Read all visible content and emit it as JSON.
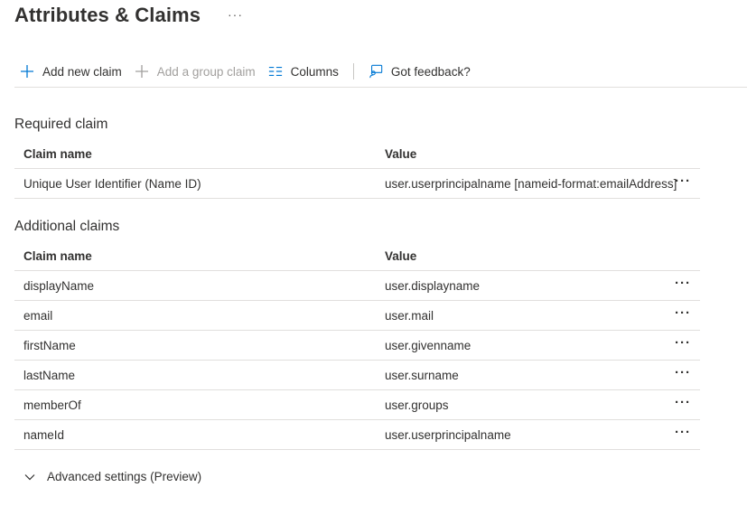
{
  "header": {
    "title": "Attributes & Claims",
    "more": "···"
  },
  "toolbar": {
    "add_claim": "Add new claim",
    "add_group_claim": "Add a group claim",
    "columns": "Columns",
    "feedback": "Got feedback?"
  },
  "required": {
    "title": "Required claim",
    "col_name": "Claim name",
    "col_value": "Value",
    "rows": [
      {
        "name": "Unique User Identifier (Name ID)",
        "value": "user.userprincipalname [nameid-format:emailAddress]"
      }
    ]
  },
  "additional": {
    "title": "Additional claims",
    "col_name": "Claim name",
    "col_value": "Value",
    "rows": [
      {
        "name": "displayName",
        "value": "user.displayname"
      },
      {
        "name": "email",
        "value": "user.mail"
      },
      {
        "name": "firstName",
        "value": "user.givenname"
      },
      {
        "name": "lastName",
        "value": "user.surname"
      },
      {
        "name": "memberOf",
        "value": "user.groups"
      },
      {
        "name": "nameId",
        "value": "user.userprincipalname"
      }
    ]
  },
  "row_more": "···",
  "advanced": {
    "label": "Advanced settings (Preview)"
  },
  "colors": {
    "accent": "#0078d4",
    "text": "#323130",
    "disabled": "#a19f9d",
    "divider": "#e1dfdd"
  }
}
